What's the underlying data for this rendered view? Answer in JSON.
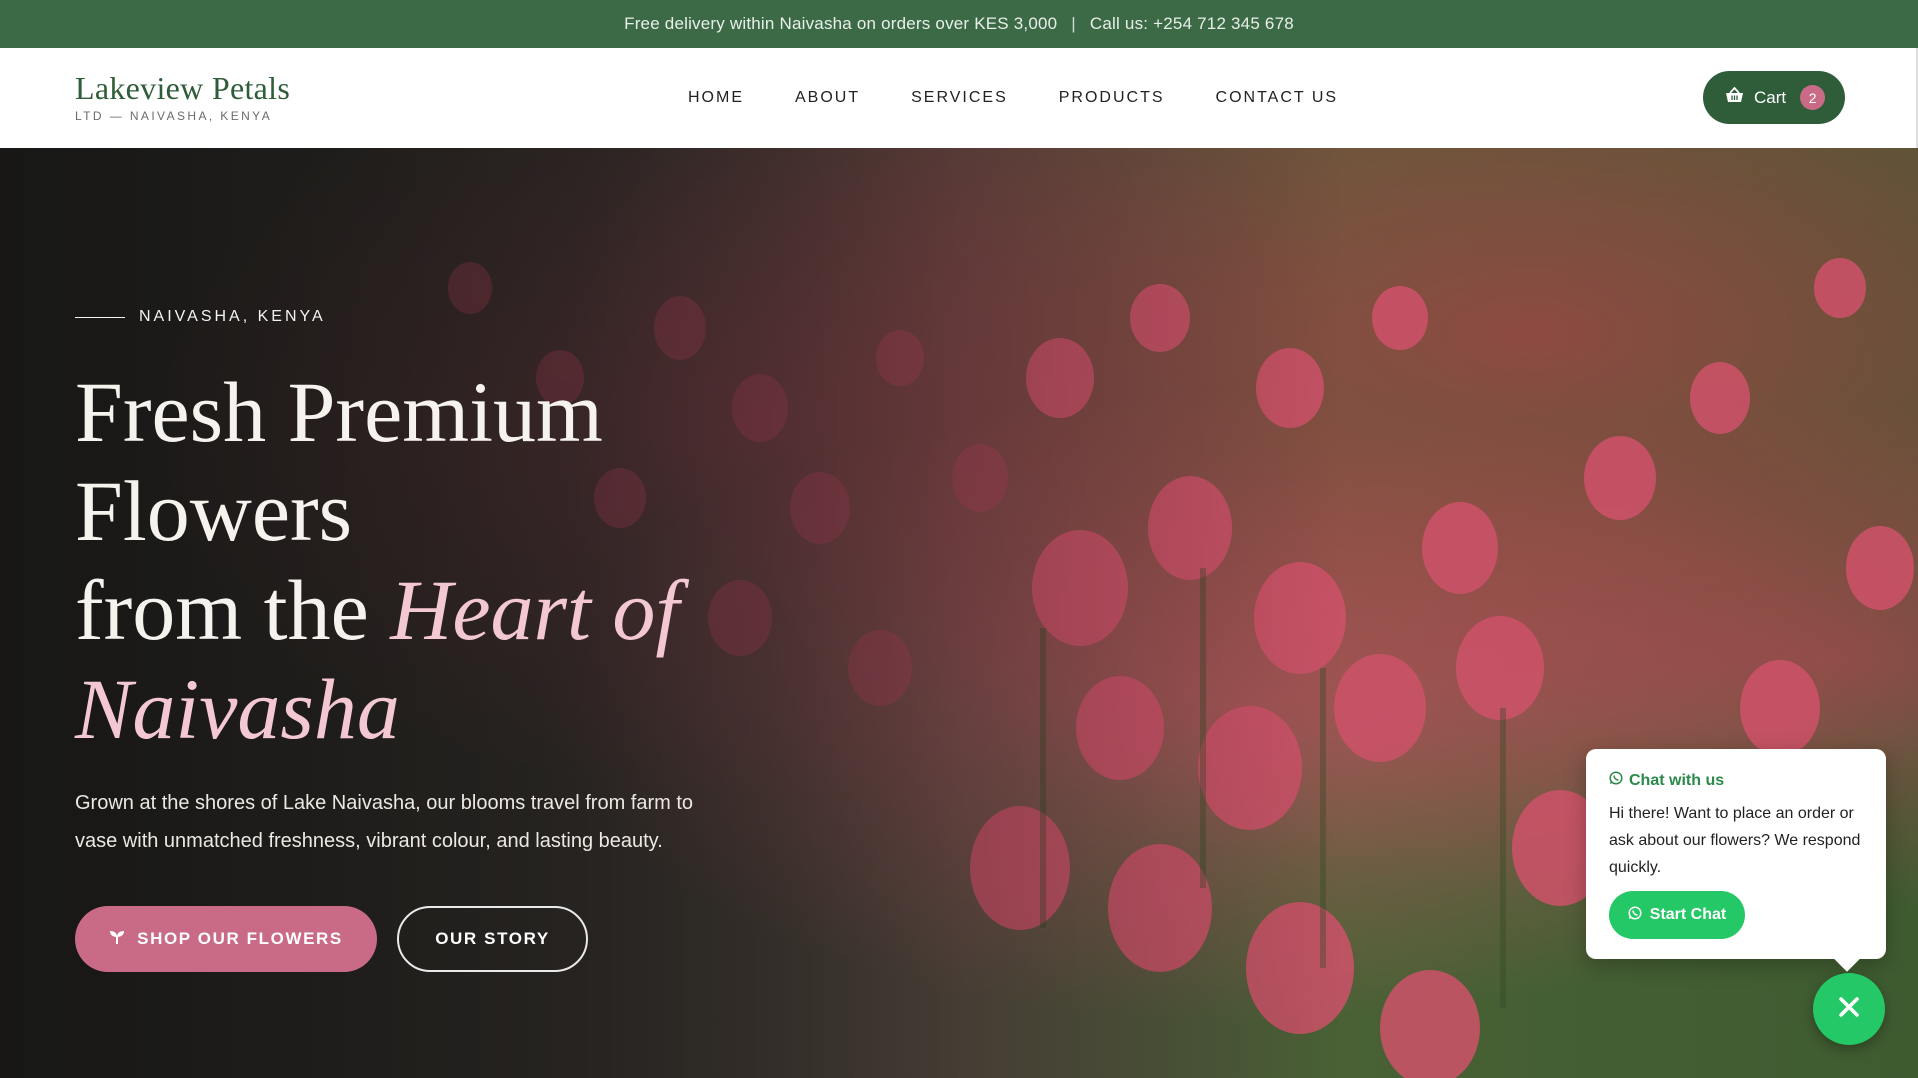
{
  "topbar": {
    "delivery": "Free delivery within Naivasha on orders over KES 3,000",
    "separator": "|",
    "phone": "Call us: +254 712 345 678"
  },
  "brand": {
    "name": "Lakeview Petals",
    "tagline": "LTD — NAIVASHA, KENYA"
  },
  "nav": {
    "items": [
      {
        "label": "HOME"
      },
      {
        "label": "ABOUT"
      },
      {
        "label": "SERVICES"
      },
      {
        "label": "PRODUCTS"
      },
      {
        "label": "CONTACT US"
      }
    ]
  },
  "cart": {
    "label": "Cart",
    "count": "2",
    "icon": "basket-icon"
  },
  "hero": {
    "eyebrow": "NAIVASHA, KENYA",
    "headline_line1": "Fresh Premium",
    "headline_line2": "Flowers",
    "headline_line3_plain": "from the ",
    "headline_line3_accent": "Heart of",
    "headline_line4_accent": "Naivasha",
    "intro": "Grown at the shores of Lake Naivasha, our blooms travel from farm to vase with unmatched freshness, vibrant colour, and lasting beauty.",
    "primary_button": "SHOP OUR FLOWERS",
    "secondary_button": "OUR STORY"
  },
  "chat": {
    "title": "Chat with us",
    "message": "Hi there! Want to place an order or ask about our flowers? We respond quickly.",
    "button": "Start Chat",
    "close_icon": "close-icon"
  },
  "colors": {
    "brand_green": "#3c6a47",
    "accent_pink": "#c96b86",
    "whatsapp_green": "#25c866"
  }
}
